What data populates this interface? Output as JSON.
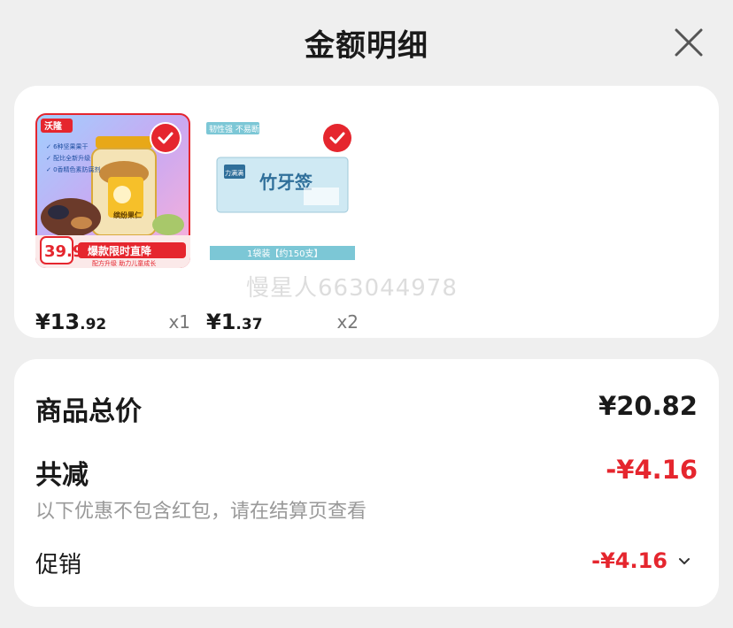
{
  "header": {
    "title": "金额明细",
    "close_icon": "close-icon"
  },
  "products": [
    {
      "badge_brand": "沃隆",
      "price_symbol": "¥",
      "price_int": "13",
      "price_dec": ".92",
      "qty": "x1",
      "image_texts": {
        "features": [
          "6种坚果果干",
          "配比全新升级",
          "0香精色素防腐剂"
        ],
        "jar_label": "缤纷果仁",
        "promo_price": "39.9",
        "promo_banner": "爆款限时直降",
        "promo_sub": "配方升级 助力儿童成长"
      }
    },
    {
      "price_symbol": "¥",
      "price_int": "1",
      "price_dec": ".37",
      "qty": "x2",
      "image_texts": {
        "top_tag": "韧性强 不易断",
        "brand": "力满满",
        "name": "竹牙签",
        "bottom": "1袋装【约150支】"
      }
    }
  ],
  "watermark": "慢星人663044978",
  "summary": {
    "total_label": "商品总价",
    "total_value": "¥20.82",
    "reduce_label": "共减",
    "reduce_value": "-¥4.16",
    "note": "以下优惠不包含红包，请在结算页查看",
    "promo_label": "促销",
    "promo_value": "-¥4.16"
  },
  "colors": {
    "accent_red": "#e5262e",
    "bg": "#efefef",
    "card": "#ffffff"
  }
}
